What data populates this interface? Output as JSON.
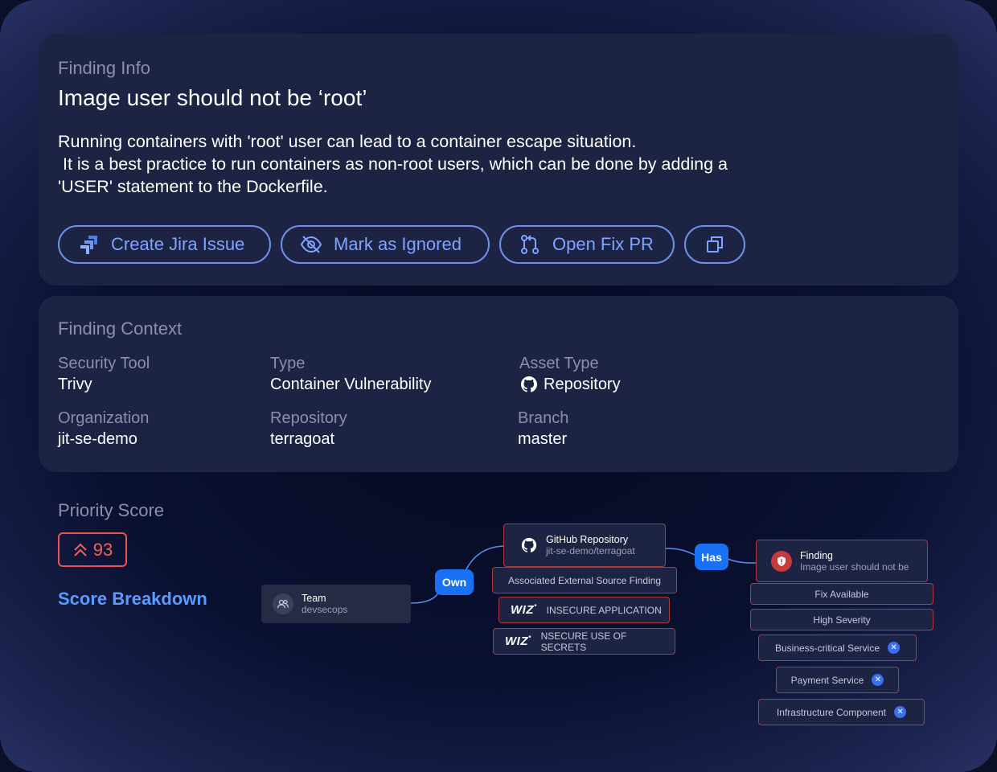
{
  "finding_info": {
    "section_title": "Finding Info",
    "title": "Image user should not be ‘root’",
    "description_lines": [
      "Running containers with 'root' user can lead to a container escape situation.",
      " It is a best practice to run containers as non-root users, which can be done by adding a",
      "'USER' statement to the Dockerfile."
    ],
    "actions": {
      "create_jira": "Create Jira Issue",
      "mark_ignored": "Mark as Ignored",
      "open_fix_pr": "Open Fix PR"
    }
  },
  "finding_context": {
    "section_title": "Finding Context",
    "fields": {
      "security_tool": {
        "label": "Security Tool",
        "value": "Trivy"
      },
      "type": {
        "label": "Type",
        "value": "Container Vulnerability"
      },
      "asset_type": {
        "label": "Asset Type",
        "value": "Repository"
      },
      "organization": {
        "label": "Organization",
        "value": "jit-se-demo"
      },
      "repository": {
        "label": "Repository",
        "value": "terragoat"
      },
      "branch": {
        "label": "Branch",
        "value": "master"
      }
    }
  },
  "priority": {
    "section_title": "Priority Score",
    "score": "93",
    "breakdown_link": "Score Breakdown"
  },
  "graph": {
    "team_node": {
      "title": "Team",
      "subtitle": "devsecops"
    },
    "own_label": "Own",
    "has_label": "Has",
    "repo_node": {
      "title": "GitHub Repository",
      "subtitle": "jit-se-demo/terragoat"
    },
    "assoc_label": "Associated External Source Finding",
    "wiz_items": [
      {
        "logo": "WIZ",
        "text": "INSECURE APPLICATION"
      },
      {
        "logo": "WIZ",
        "text": "NSECURE USE OF SECRETS"
      }
    ],
    "finding_node": {
      "title": "Finding",
      "subtitle": "Image user should not be"
    },
    "finding_tags": [
      "Fix Available",
      "High Severity"
    ],
    "context_tags": [
      "Business-critical Service",
      "Payment Service",
      "Infrastructure Component"
    ]
  },
  "colors": {
    "accent_blue": "#7fa3ff",
    "pill_blue": "#1971f5",
    "score_red": "#f0625c"
  }
}
